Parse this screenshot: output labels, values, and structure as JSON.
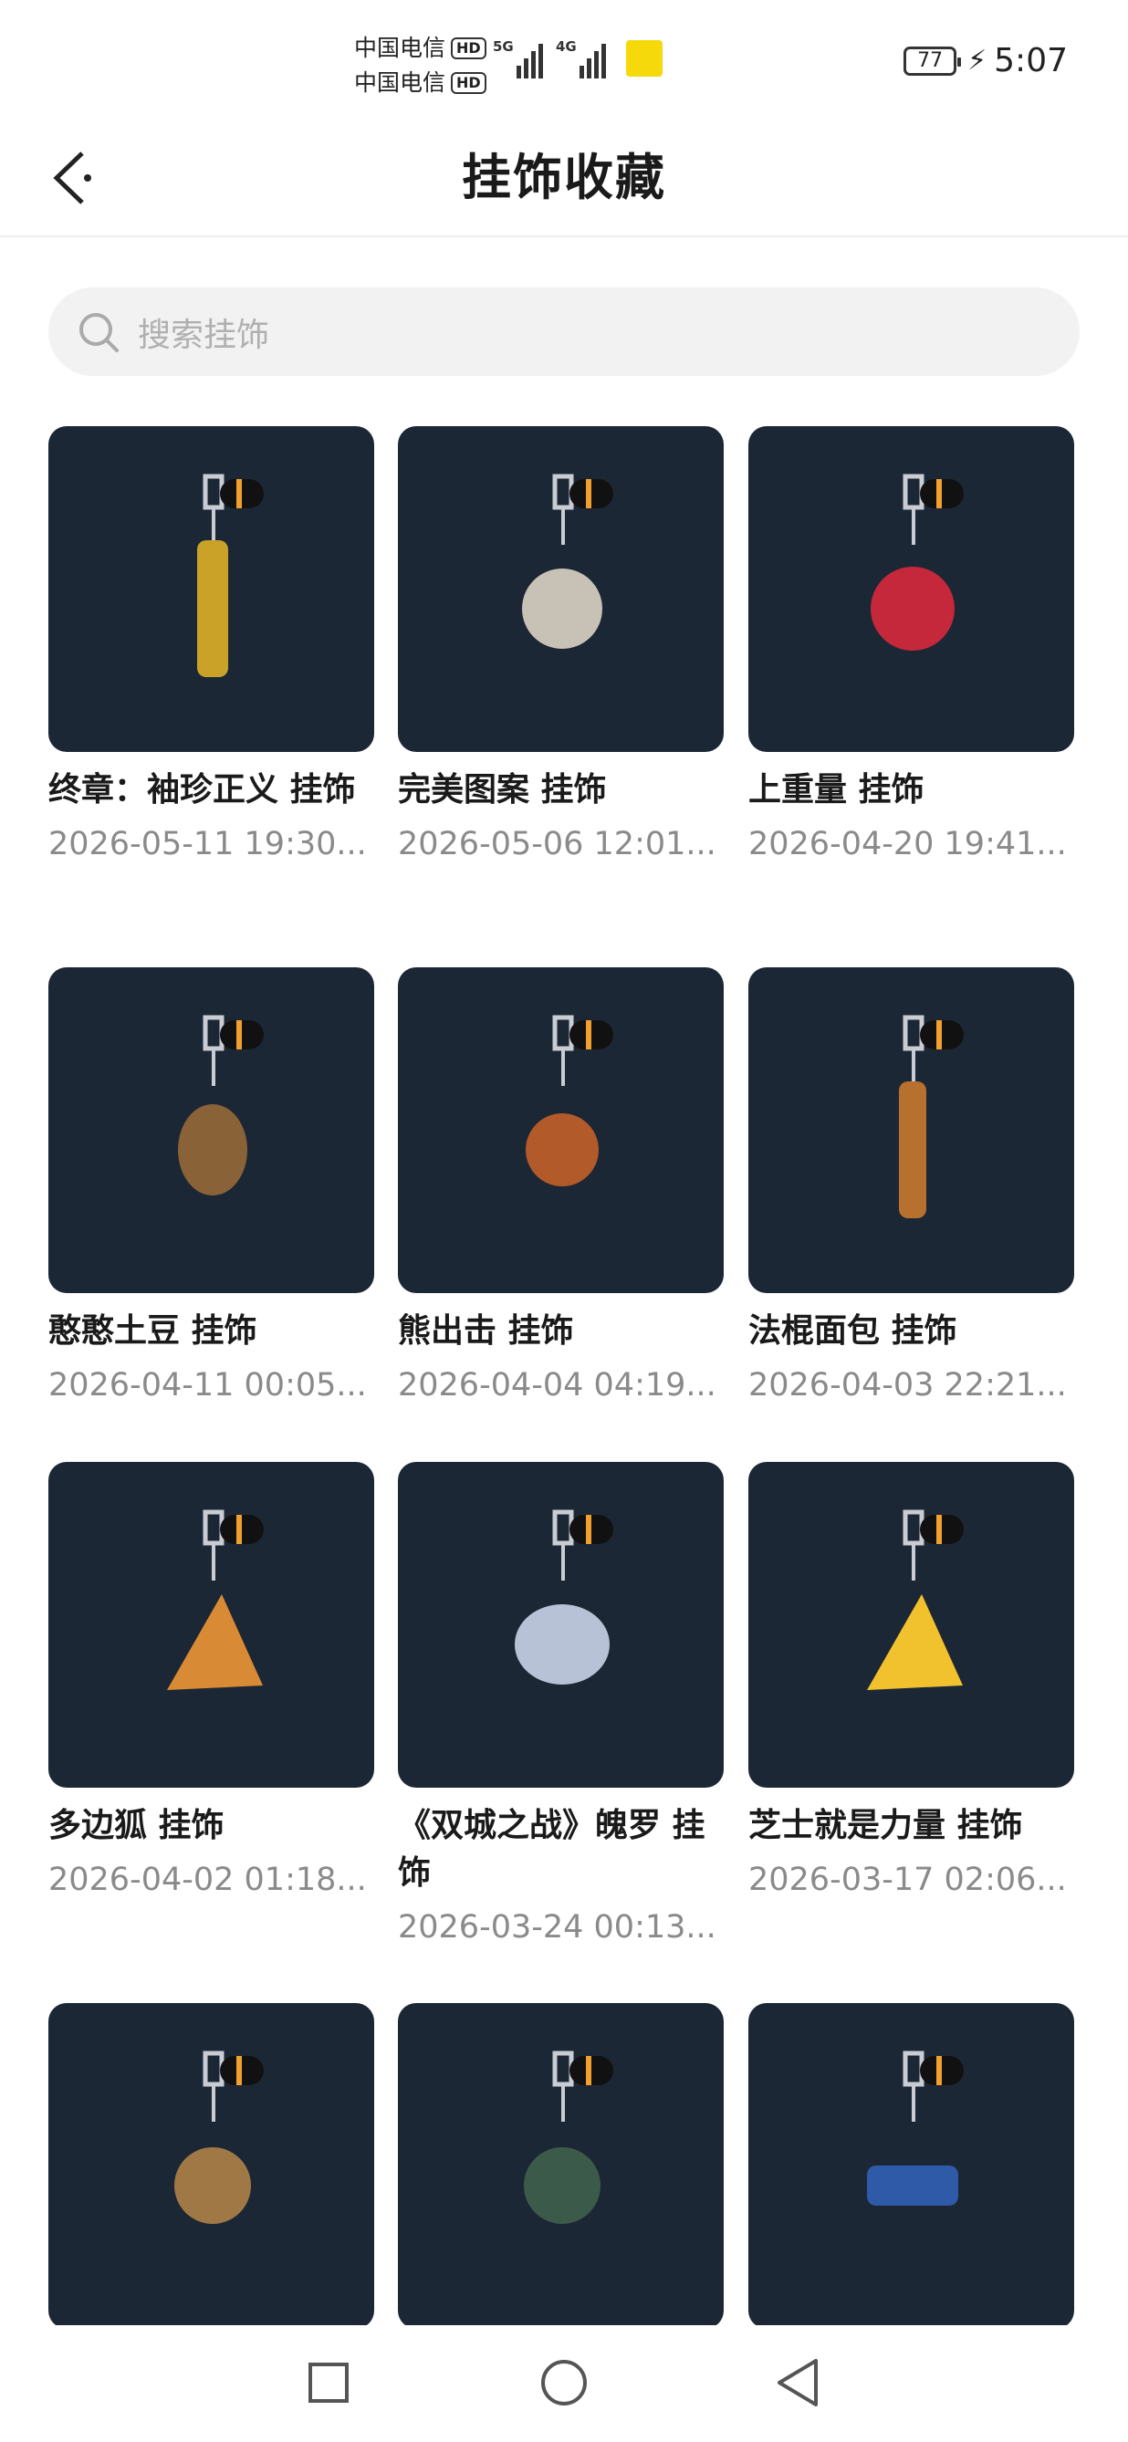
{
  "status": {
    "carrier1": "中国电信",
    "carrier2": "中国电信",
    "hd": "HD",
    "net1": "5G",
    "net2": "4G",
    "battery": "77",
    "time": "5:07"
  },
  "header": {
    "title": "挂饰收藏"
  },
  "search": {
    "placeholder": "搜索挂饰"
  },
  "colors": {
    "card_bg": "#1c2735",
    "accent_orange": "#f0a030"
  },
  "items": [
    {
      "title": " 终章：袖珍正义 挂饰",
      "date": "2026-05-11 19:30...",
      "icon": "golden-gun-charm"
    },
    {
      "title": "完美图案 挂饰",
      "date": "2026-05-06 12:01...",
      "icon": "doll-charm"
    },
    {
      "title": " 上重量 挂饰",
      "date": "2026-04-20 19:41...",
      "icon": "kettlebell-charm"
    },
    {
      "title": "憨憨土豆 挂饰",
      "date": "2026-04-11 00:05...",
      "icon": "potato-charm"
    },
    {
      "title": "熊出击 挂饰",
      "date": "2026-04-04 04:19...",
      "icon": "bear-charm"
    },
    {
      "title": "法棍面包 挂饰",
      "date": "2026-04-03 22:21...",
      "icon": "baguette-charm"
    },
    {
      "title": "多边狐 挂饰",
      "date": "2026-04-02 01:18...",
      "icon": "fox-charm"
    },
    {
      "title": "《双城之战》魄罗 挂饰",
      "date": "2026-03-24 00:13...",
      "icon": "poro-charm"
    },
    {
      "title": "芝士就是力量 挂饰",
      "date": "2026-03-17 02:06...",
      "icon": "cheese-charm"
    },
    {
      "title": "",
      "date": "",
      "icon": "corgi-medal-charm"
    },
    {
      "title": "",
      "date": "",
      "icon": "plant-drop-charm"
    },
    {
      "title": "",
      "date": "",
      "icon": "boat-charm"
    }
  ]
}
